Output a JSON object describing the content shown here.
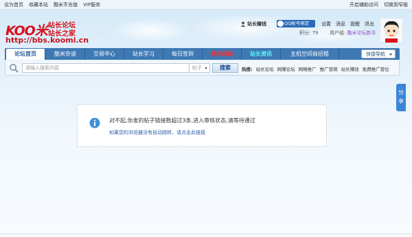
{
  "topbar": {
    "left": [
      "设为首页",
      "收藏本站",
      "酷米币充值",
      "VIP服务"
    ],
    "right": [
      "开启辅助访问",
      "切换到窄版"
    ]
  },
  "logo": {
    "brand": "KOO米",
    "slogan1": "站长论坛",
    "slogan2": "站长之家",
    "url": "http://bbs.koomi.cn"
  },
  "user": {
    "title": "站长赚钱",
    "qq_button": "QQ帐号绑定",
    "links": [
      "设置",
      "消息",
      "提醒",
      "退出"
    ],
    "points_label": "积分: 79",
    "group_label": "用户组:",
    "group_value": "酷米论坛新手"
  },
  "nav": {
    "tabs": [
      "论坛首页",
      "酷米杂谈",
      "交易中心",
      "站长学习",
      "每日签到",
      "酷米商城",
      "站长资讯",
      "主机空间商招租"
    ],
    "quick_nav": "快捷导航"
  },
  "search": {
    "placeholder": "请输入搜索内容",
    "type": "帖子",
    "button": "搜索",
    "hot_label": "热搜:",
    "hot_terms": [
      "站长论坛",
      "网赚论坛",
      "网络推广",
      "推广营销",
      "站长赚钱",
      "免费推广营位"
    ]
  },
  "share": "分享",
  "message": {
    "main": "对不起,你发的帖子链接数超过3条,进入审核状态,请等待通过",
    "sub": "如果您的浏览器没有自动跳转，请点击此链接"
  },
  "colors": {
    "nav_bg": "#3e79b4",
    "brand_red": "#d8101a",
    "link_blue": "#2a5fa8",
    "share_bg": "#3a86d6"
  }
}
